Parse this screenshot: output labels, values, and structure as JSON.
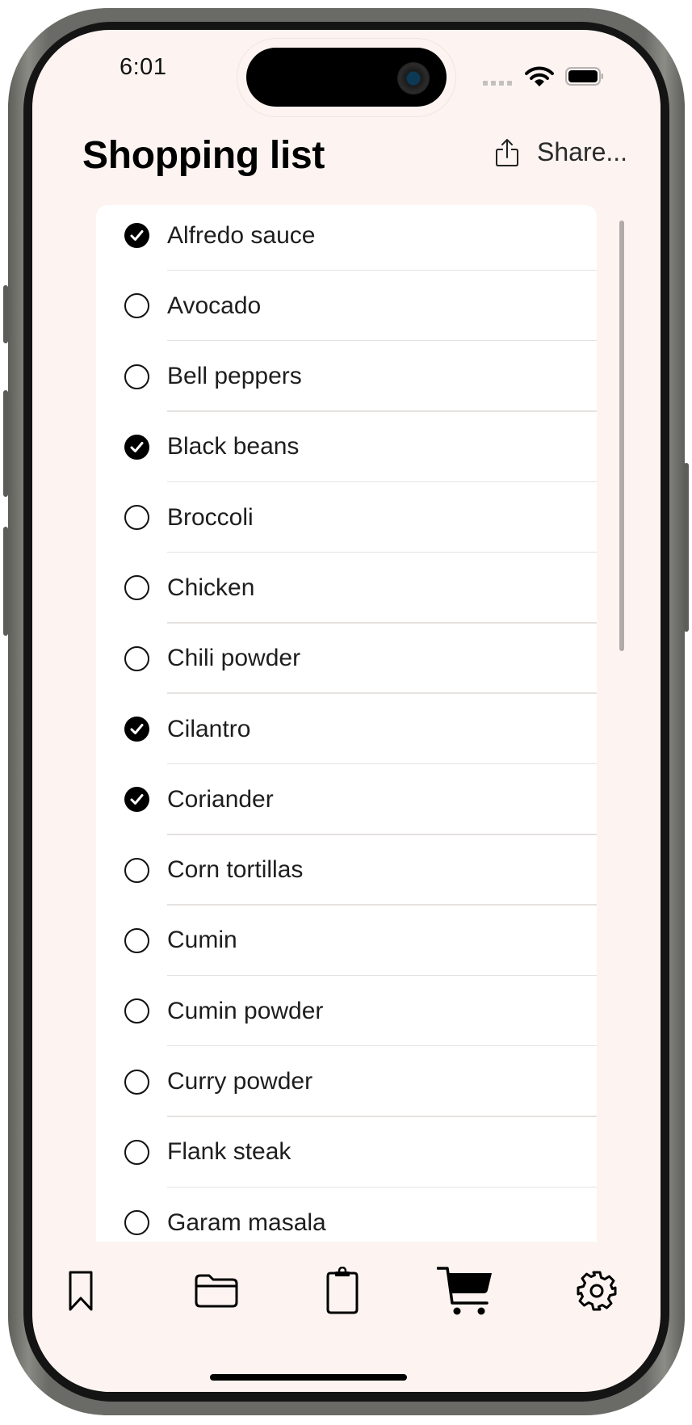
{
  "status_bar": {
    "time": "6:01",
    "icons": [
      "cellular-signal-icon",
      "wifi-icon",
      "battery-icon"
    ]
  },
  "header": {
    "title": "Shopping list",
    "share": {
      "label": "Share...",
      "icon": "share-icon"
    }
  },
  "list": {
    "items": [
      {
        "label": "Alfredo sauce",
        "checked": true
      },
      {
        "label": "Avocado",
        "checked": false
      },
      {
        "label": "Bell peppers",
        "checked": false
      },
      {
        "label": "Black beans",
        "checked": true
      },
      {
        "label": "Broccoli",
        "checked": false
      },
      {
        "label": "Chicken",
        "checked": false
      },
      {
        "label": "Chili powder",
        "checked": false
      },
      {
        "label": "Cilantro",
        "checked": true
      },
      {
        "label": "Coriander",
        "checked": true
      },
      {
        "label": "Corn tortillas",
        "checked": false
      },
      {
        "label": "Cumin",
        "checked": false
      },
      {
        "label": "Cumin powder",
        "checked": false
      },
      {
        "label": "Curry powder",
        "checked": false
      },
      {
        "label": "Flank steak",
        "checked": false
      },
      {
        "label": "Garam masala",
        "checked": false
      }
    ]
  },
  "tab_bar": {
    "tabs": [
      {
        "icon": "bookmark-icon",
        "selected": false
      },
      {
        "icon": "folder-icon",
        "selected": false
      },
      {
        "icon": "clipboard-icon",
        "selected": false
      },
      {
        "icon": "cart-icon",
        "selected": true
      },
      {
        "icon": "gear-icon",
        "selected": false
      }
    ]
  },
  "colors": {
    "background": "#fdf4f1",
    "card": "#ffffff",
    "text": "#1e1e1e",
    "accent": "#000000"
  }
}
